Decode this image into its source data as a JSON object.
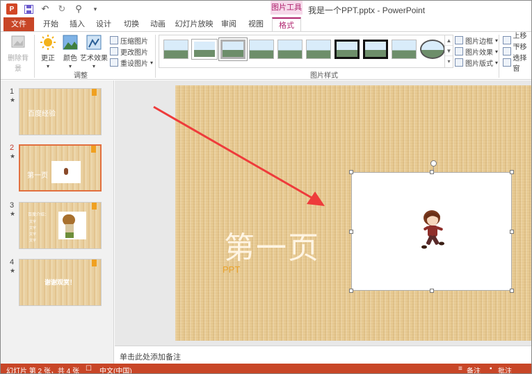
{
  "window": {
    "title": "我是一个PPT.pptx - PowerPoint",
    "context_tab_group": "图片工具"
  },
  "qat": {
    "app_icon": "powerpoint-icon",
    "save_icon": "save-icon",
    "undo_icon": "undo-icon",
    "redo_icon": "redo-icon",
    "present_icon": "start-from-beginning-icon",
    "customize_icon": "customize-qat-icon"
  },
  "tabs": [
    "文件",
    "开始",
    "插入",
    "设计",
    "切换",
    "动画",
    "幻灯片放映",
    "审阅",
    "视图",
    "格式"
  ],
  "ribbon": {
    "remove_bg": "删除背景",
    "corrections": "更正",
    "color": "颜色",
    "artistic": "艺术效果",
    "compress": "压缩图片",
    "change": "更改图片",
    "reset": "重设图片",
    "adjust_group": "调整",
    "styles_group": "图片样式",
    "border": "图片边框",
    "effects": "图片效果",
    "layout": "图片版式",
    "bring_forward": "上移一",
    "send_backward": "下移一",
    "selection_pane": "选择窗"
  },
  "slides": [
    {
      "num": "1",
      "text": "百度经验"
    },
    {
      "num": "2",
      "text": "第一页"
    },
    {
      "num": "3",
      "text": "百度介绍："
    },
    {
      "num": "4",
      "text": "谢谢观赏！"
    }
  ],
  "thumb3_lines": [
    "文字",
    "文字",
    "文字",
    "文字"
  ],
  "slide": {
    "title": "第一页",
    "subtitle": "PPT"
  },
  "notes_placeholder": "单击此处添加备注",
  "status": {
    "slide_info": "幻灯片 第 2 张，共 4 张",
    "language": "中文(中国)",
    "notes": "备注",
    "comments": "批注"
  },
  "colors": {
    "accent": "#c84627",
    "picture_tools": "#b0246f",
    "slide_bg": "#e8cb94"
  }
}
